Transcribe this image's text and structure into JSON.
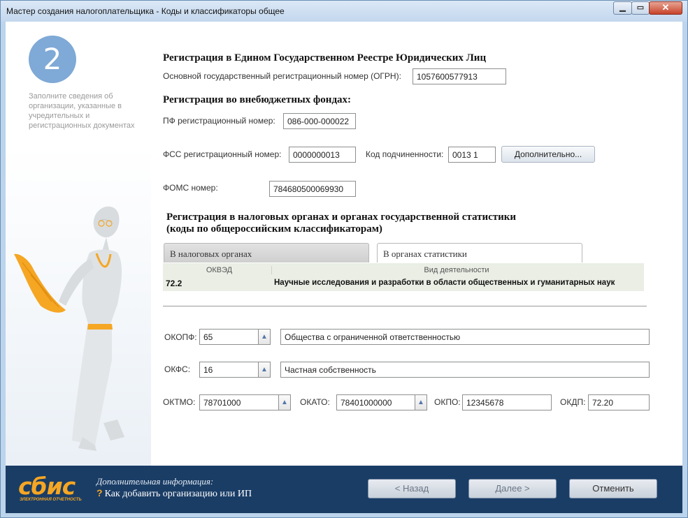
{
  "window": {
    "title": "Мастер создания налогоплательщика - Коды и классификаторы общее",
    "min_label": "▁",
    "max_label": "▭",
    "close_label": "✕"
  },
  "step": {
    "number": "2",
    "description": "Заполните сведения об организации, указанные в учредительных и регистрационных документах"
  },
  "egrul": {
    "heading": "Регистрация в Едином Государственном Реестре Юридических Лиц",
    "ogrn_label": "Основной государственный регистрационный номер (ОГРН):",
    "ogrn_value": "1057600577913"
  },
  "funds": {
    "heading": "Регистрация во внебюджетных фондах:",
    "pf_label": "ПФ регистрационный номер:",
    "pf_value": "086-000-000022",
    "fss_label": "ФСС регистрационный номер:",
    "fss_value": "0000000013",
    "kod_label": "Код подчиненности:",
    "kod_value": "0013 1",
    "more_button": "Дополнительно...",
    "foms_label": "ФОМС номер:",
    "foms_value": "784680500069930"
  },
  "tax": {
    "heading_line1": "Регистрация в налоговых органах и органах государственной статистики",
    "heading_line2": "(коды по общероссийским классификаторам)",
    "tabs": [
      {
        "label": "В налоговых органах",
        "active": false
      },
      {
        "label": "В органах статистики",
        "active": true
      }
    ],
    "grid": {
      "columns": [
        "ОКВЭД",
        "Вид деятельности"
      ],
      "rows": [
        {
          "code": "72.2",
          "activity": "Научные исследования и разработки в области общественных и гуманитарных наук"
        }
      ]
    }
  },
  "classifiers": {
    "okopf_label": "ОКОПФ:",
    "okopf_code": "65",
    "okopf_desc": "Общества с ограниченной ответственностью",
    "okfs_label": "ОКФС:",
    "okfs_code": "16",
    "okfs_desc": "Частная собственность",
    "oktmo_label": "ОКТМО:",
    "oktmo_value": "78701000",
    "okato_label": "ОКАТО:",
    "okato_value": "78401000000",
    "okpo_label": "ОКПО:",
    "okpo_value": "12345678",
    "okdp_label": "ОКДП:",
    "okdp_value": "72.20"
  },
  "footer": {
    "logo": "сбис",
    "logo_sub": "ЭЛЕКТРОННАЯ ОТЧЕТНОСТЬ",
    "info_title": "Дополнительная информация:",
    "info_link": "Как добавить организацию или ИП",
    "back_button": "< Назад",
    "next_button": "Далее >",
    "cancel_button": "Отменить"
  },
  "colors": {
    "accent": "#f5a623",
    "footer": "#1a3d66",
    "step_circle": "#7fa9d6"
  }
}
